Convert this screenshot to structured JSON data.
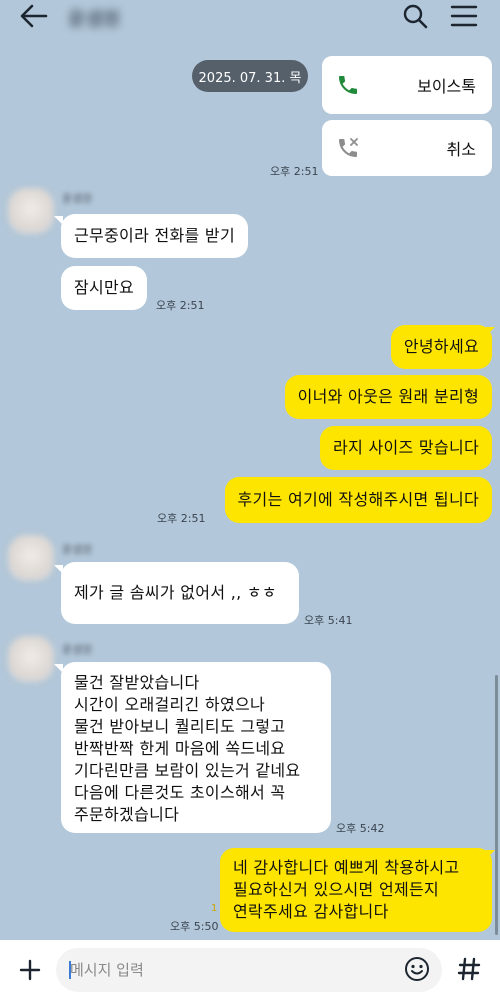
{
  "header": {
    "title": "윤샘원"
  },
  "icons": {
    "back": "arrow-left-icon",
    "search": "search-icon",
    "menu": "hamburger-menu-icon",
    "voice_call": "phone-icon",
    "cancelled_call": "phone-cancelled-icon",
    "plus": "plus-icon",
    "emoji": "smiley-icon",
    "hash": "hash-icon"
  },
  "colors": {
    "chat_background": "#b2c7d9",
    "my_bubble": "#fee500",
    "their_bubble": "#ffffff",
    "call_icon_green": "#1e8a3a",
    "date_pill": "#55606b"
  },
  "chat": {
    "date_divider": "2025. 07. 31. 목",
    "calls": [
      {
        "label": "보이스톡"
      },
      {
        "label": "취소"
      }
    ],
    "calls_time": "오후 2:51",
    "group1": {
      "sender": "윤샘원",
      "messages": [
        "근무중이라 전화를 받기",
        "잠시만요"
      ],
      "time": "오후 2:51"
    },
    "my_group1": {
      "messages": [
        "안녕하세요",
        "이너와 아웃은 원래 분리형",
        "라지 사이즈 맞습니다",
        "후기는 여기에 작성해주시면 됩니다"
      ],
      "time": "오후 2:51"
    },
    "group2": {
      "sender": "윤샘원",
      "messages": [
        "제가 글 솜씨가 없어서 ,, ㅎㅎ"
      ],
      "time": "오후 5:41"
    },
    "group3": {
      "sender": "윤샘원",
      "message": "물건 잘받았습니다\n시간이 오래걸리긴 하였으나\n물건 받아보니 퀄리티도 그렇고\n반짝반짝 한게 마음에 쏙드네요\n기다린만큼 보람이 있는거 같네요\n다음에 다른것도 초이스해서 꼭\n주문하겠습니다",
      "time": "오후 5:42"
    },
    "my_group2": {
      "message": "네 감사합니다 예쁘게 착용하시고\n필요하신거 있으시면 언제든지\n연락주세요 감사합니다",
      "unread": "1",
      "time": "오후 5:50"
    }
  },
  "input": {
    "placeholder": "메시지 입력",
    "value": ""
  }
}
